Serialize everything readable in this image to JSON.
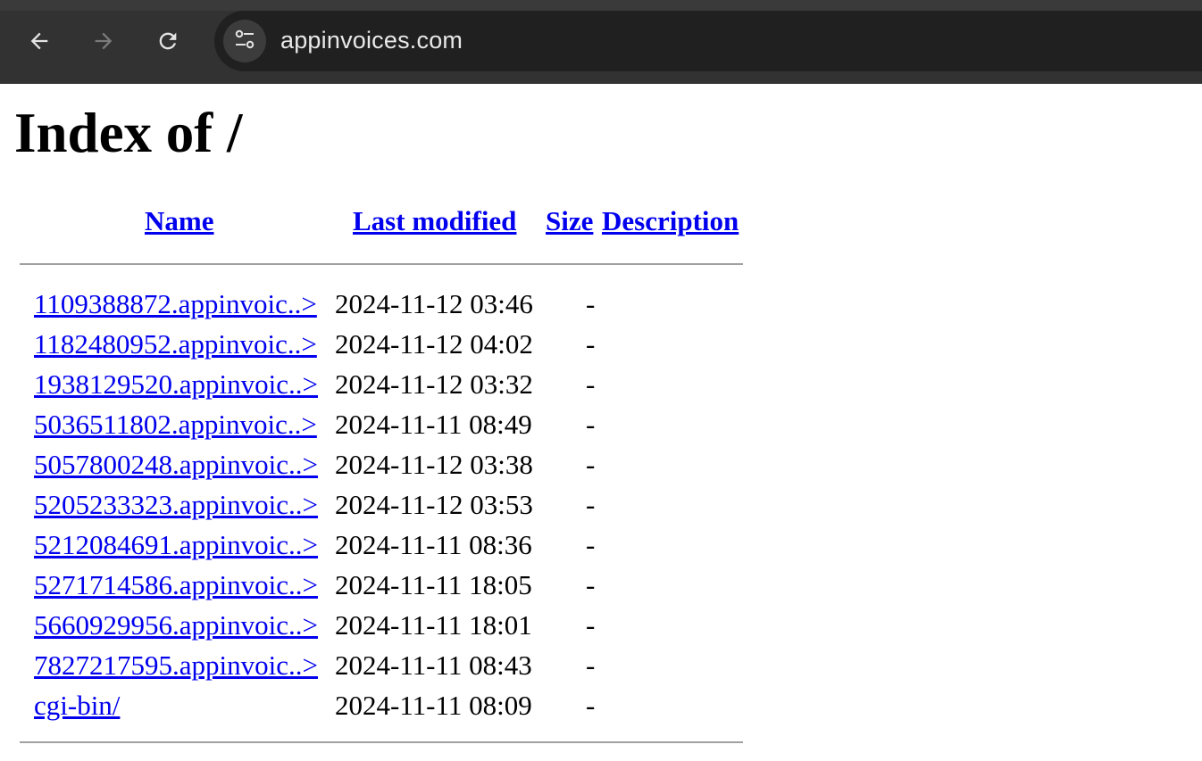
{
  "browser": {
    "url": "appinvoices.com",
    "back_icon": "arrow-left-icon",
    "forward_icon": "arrow-right-icon",
    "reload_icon": "reload-icon",
    "site_info_icon": "tune-icon"
  },
  "page": {
    "title": "Index of /",
    "columns": {
      "name": "Name",
      "last_modified": "Last modified",
      "size": "Size",
      "description": "Description"
    },
    "rows": [
      {
        "name": "1109388872.appinvoic..>",
        "modified": "2024-11-12 03:46",
        "size": "-",
        "description": ""
      },
      {
        "name": "1182480952.appinvoic..>",
        "modified": "2024-11-12 04:02",
        "size": "-",
        "description": ""
      },
      {
        "name": "1938129520.appinvoic..>",
        "modified": "2024-11-12 03:32",
        "size": "-",
        "description": ""
      },
      {
        "name": "5036511802.appinvoic..>",
        "modified": "2024-11-11 08:49",
        "size": "-",
        "description": ""
      },
      {
        "name": "5057800248.appinvoic..>",
        "modified": "2024-11-12 03:38",
        "size": "-",
        "description": ""
      },
      {
        "name": "5205233323.appinvoic..>",
        "modified": "2024-11-12 03:53",
        "size": "-",
        "description": ""
      },
      {
        "name": "5212084691.appinvoic..>",
        "modified": "2024-11-11 08:36",
        "size": "-",
        "description": ""
      },
      {
        "name": "5271714586.appinvoic..>",
        "modified": "2024-11-11 18:05",
        "size": "-",
        "description": ""
      },
      {
        "name": "5660929956.appinvoic..>",
        "modified": "2024-11-11 18:01",
        "size": "-",
        "description": ""
      },
      {
        "name": "7827217595.appinvoic..>",
        "modified": "2024-11-11 08:43",
        "size": "-",
        "description": ""
      },
      {
        "name": "cgi-bin/",
        "modified": "2024-11-11 08:09",
        "size": "-",
        "description": ""
      }
    ]
  },
  "colors": {
    "link": "#0000ee",
    "toolbar": "#323232",
    "omnibox": "#202020",
    "rule": "#a0a0a0"
  }
}
